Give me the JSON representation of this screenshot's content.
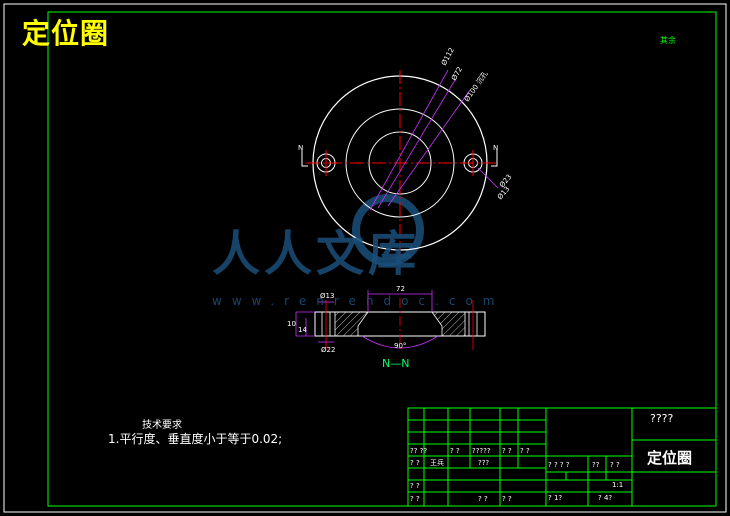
{
  "drawing": {
    "title": "定位圈",
    "corner_note": "其余",
    "section_label": "N—N",
    "technical_requirements": {
      "heading": "技术要求",
      "item1": "1.平行度、垂直度小于等于0.02;"
    },
    "dimensions": {
      "d112": "Ø112",
      "d72_top": "Ø72",
      "d100": "Ø100 沉孔",
      "d23": "Ø23",
      "d13_top": "Ø13",
      "d13_side": "Ø13",
      "w72": "72",
      "h10": "10",
      "h14": "14",
      "d22": "Ø22",
      "angle": "90°",
      "section_mark_left": "N",
      "section_mark_right": "N"
    },
    "title_block": {
      "part_name": "定位圈",
      "drawing_no": "????",
      "row_labels": [
        "?? ??",
        "? ?",
        "?????",
        "? ?",
        "? ?"
      ],
      "designer": "王兵",
      "cell_a": "???",
      "cell_b": "? ? ? ?",
      "cell_c": "??",
      "cell_d": "? ?",
      "cell_e": "? ?",
      "scale": "1:1",
      "sheet": "? 1?",
      "sheet2": "? 4?",
      "row3_left": "? ?",
      "row3_mid": "? ?",
      "row4_left": "? ?",
      "row4_mid": "? ?"
    },
    "watermark": {
      "text": "人人文库",
      "url": "www.renrendoc.com"
    },
    "colors": {
      "border": "#00ff00",
      "centerline": "#ff0000",
      "leader": "#cc33ff",
      "outline": "#ffffff",
      "title": "#ffff00"
    }
  }
}
